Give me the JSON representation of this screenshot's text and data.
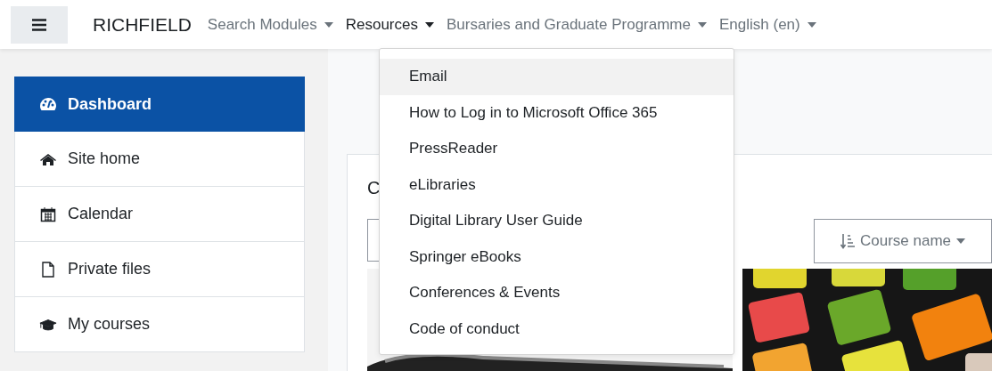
{
  "navbar": {
    "brand": "RICHFIELD",
    "menu": [
      {
        "label": "Search Modules",
        "selected": false
      },
      {
        "label": "Resources",
        "selected": true
      },
      {
        "label": "Bursaries and Graduate Programme",
        "selected": false
      },
      {
        "label": "English (en)",
        "selected": false
      }
    ]
  },
  "sidebar": {
    "items": [
      {
        "label": "Dashboard",
        "kind": "dashboard",
        "selected": true
      },
      {
        "label": "Site home",
        "kind": "home",
        "selected": false
      },
      {
        "label": "Calendar",
        "kind": "calendar",
        "selected": false
      },
      {
        "label": "Private files",
        "kind": "file",
        "selected": false
      },
      {
        "label": "My courses",
        "kind": "courses",
        "selected": false
      }
    ]
  },
  "main": {
    "heading": "C",
    "sort_button": {
      "label": "Course name"
    }
  },
  "dropdown": {
    "items": [
      {
        "label": "Email",
        "selected": true
      },
      {
        "label": "How to Log in to Microsoft Office 365",
        "selected": false
      },
      {
        "label": "PressReader",
        "selected": false
      },
      {
        "label": "eLibraries",
        "selected": false
      },
      {
        "label": "Digital Library User Guide",
        "selected": false
      },
      {
        "label": "Springer eBooks",
        "selected": false
      },
      {
        "label": "Conferences & Events",
        "selected": false
      },
      {
        "label": "Code of conduct",
        "selected": false
      }
    ]
  }
}
